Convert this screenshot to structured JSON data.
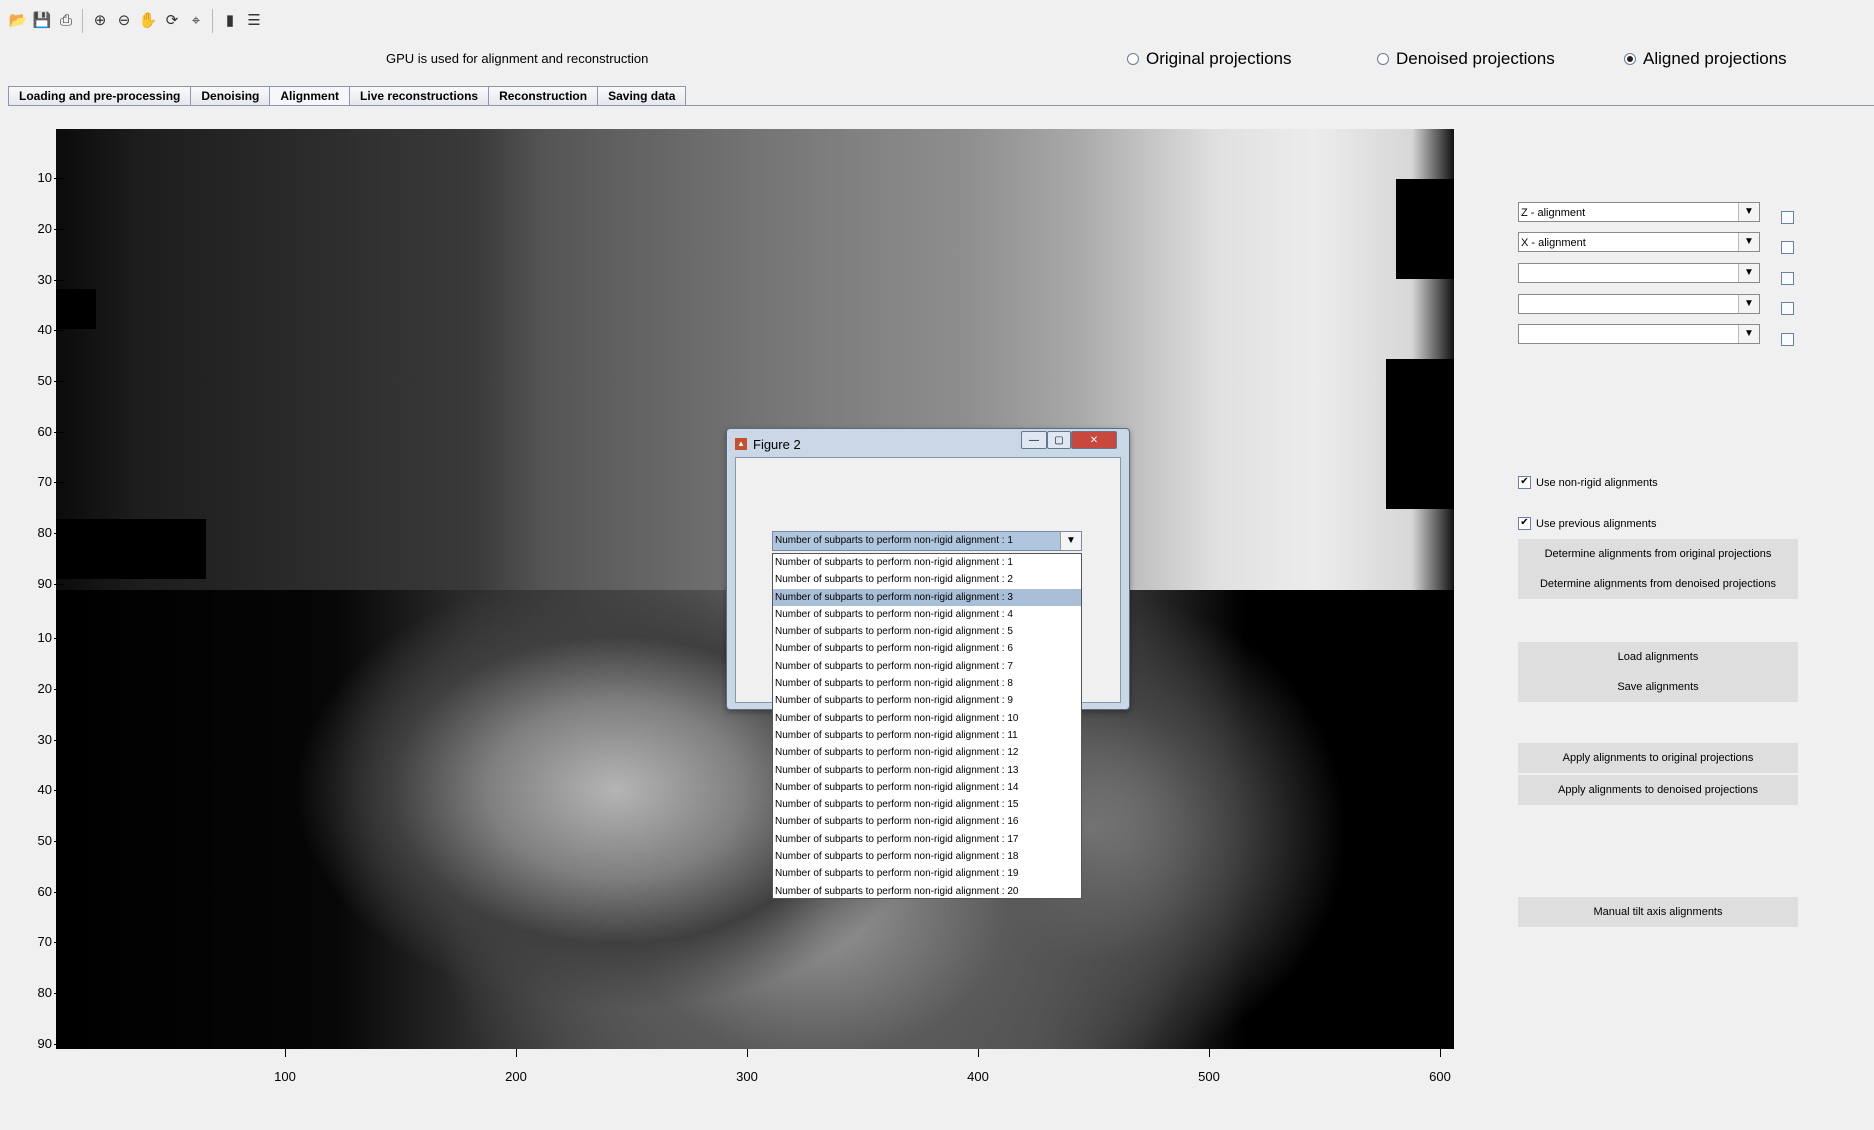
{
  "toolbar": {
    "icons": [
      "open-icon",
      "save-icon",
      "print-icon",
      "zoom-in-icon",
      "zoom-out-icon",
      "pan-icon",
      "rotate-icon",
      "data-cursor-icon",
      "colorbar-icon",
      "legend-icon"
    ]
  },
  "status_text": "GPU is used for alignment and reconstruction",
  "view_options": [
    {
      "label": "Original projections",
      "selected": false
    },
    {
      "label": "Denoised projections",
      "selected": false
    },
    {
      "label": "Aligned projections",
      "selected": true
    }
  ],
  "tabs": [
    {
      "label": "Loading and pre-processing",
      "active": false
    },
    {
      "label": "Denoising",
      "active": false
    },
    {
      "label": "Alignment",
      "active": true
    },
    {
      "label": "Live reconstructions",
      "active": false
    },
    {
      "label": "Reconstruction",
      "active": false
    },
    {
      "label": "Saving data",
      "active": false
    }
  ],
  "plot": {
    "y_ticks_top": [
      "10",
      "20",
      "30",
      "40",
      "50",
      "60",
      "70",
      "80",
      "90"
    ],
    "y_ticks_bottom": [
      "10",
      "20",
      "30",
      "40",
      "50",
      "60",
      "70",
      "80",
      "90"
    ],
    "x_ticks": [
      "100",
      "200",
      "300",
      "400",
      "500",
      "600"
    ]
  },
  "alignment_selectors": [
    {
      "value": ""
    },
    {
      "value": ""
    },
    {
      "value": ""
    },
    {
      "value": ""
    },
    {
      "value": ""
    }
  ],
  "alignment_selector_values": [
    "Z - alignment",
    "X - alignment",
    "",
    "",
    ""
  ],
  "options": {
    "use_non_rigid": "Use non-rigid alignments",
    "use_previous": "Use previous alignments"
  },
  "buttons": {
    "determine_original": "Determine alignments from original projections",
    "determine_denoised": "Determine alignments from denoised projections",
    "load": "Load alignments",
    "save": "Save alignments",
    "apply_original": "Apply alignments to original projections",
    "apply_denoised": "Apply alignments to denoised projections",
    "manual_tilt": "Manual tilt axis alignments"
  },
  "dialog": {
    "title": "Figure 2",
    "selected_value": "Number of subparts to perform non-rigid alignment : 1",
    "options": [
      "Number of subparts to perform non-rigid alignment : 1",
      "Number of subparts to perform non-rigid alignment : 2",
      "Number of subparts to perform non-rigid alignment : 3",
      "Number of subparts to perform non-rigid alignment : 4",
      "Number of subparts to perform non-rigid alignment : 5",
      "Number of subparts to perform non-rigid alignment : 6",
      "Number of subparts to perform non-rigid alignment : 7",
      "Number of subparts to perform non-rigid alignment : 8",
      "Number of subparts to perform non-rigid alignment : 9",
      "Number of subparts to perform non-rigid alignment : 10",
      "Number of subparts to perform non-rigid alignment : 11",
      "Number of subparts to perform non-rigid alignment : 12",
      "Number of subparts to perform non-rigid alignment : 13",
      "Number of subparts to perform non-rigid alignment : 14",
      "Number of subparts to perform non-rigid alignment : 15",
      "Number of subparts to perform non-rigid alignment : 16",
      "Number of subparts to perform non-rigid alignment : 17",
      "Number of subparts to perform non-rigid alignment : 18",
      "Number of subparts to perform non-rigid alignment : 19",
      "Number of subparts to perform non-rigid alignment : 20"
    ],
    "highlighted_index": 2
  }
}
